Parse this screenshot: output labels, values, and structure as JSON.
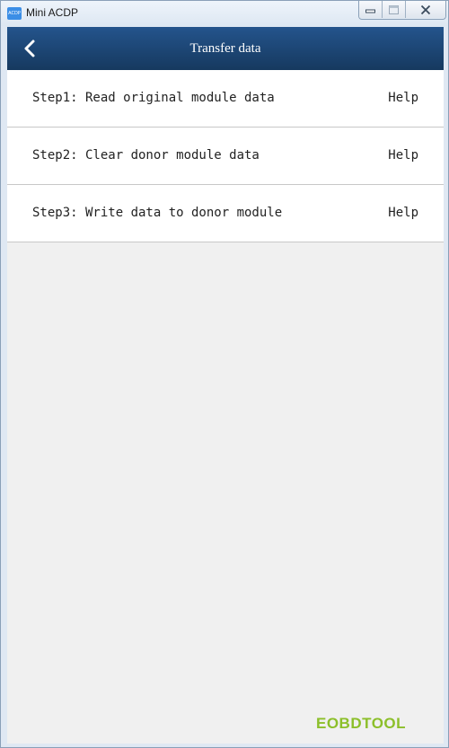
{
  "window": {
    "title": "Mini ACDP",
    "icon_label": "ACDP",
    "controls": [
      "minimize-icon",
      "maximize-icon",
      "close-icon"
    ]
  },
  "header": {
    "title": "Transfer data",
    "back_icon": "chevron-left-icon"
  },
  "steps": [
    {
      "label": "Step1: Read original module data",
      "help": "Help"
    },
    {
      "label": "Step2: Clear donor module data",
      "help": "Help"
    },
    {
      "label": "Step3: Write data to donor module",
      "help": "Help"
    }
  ],
  "watermark": {
    "text": "EOBDTOOL"
  },
  "colors": {
    "navbar": "#1d4678",
    "background": "#f0f0f0",
    "row_background": "#ffffff",
    "watermark": "#8cbf2a"
  }
}
